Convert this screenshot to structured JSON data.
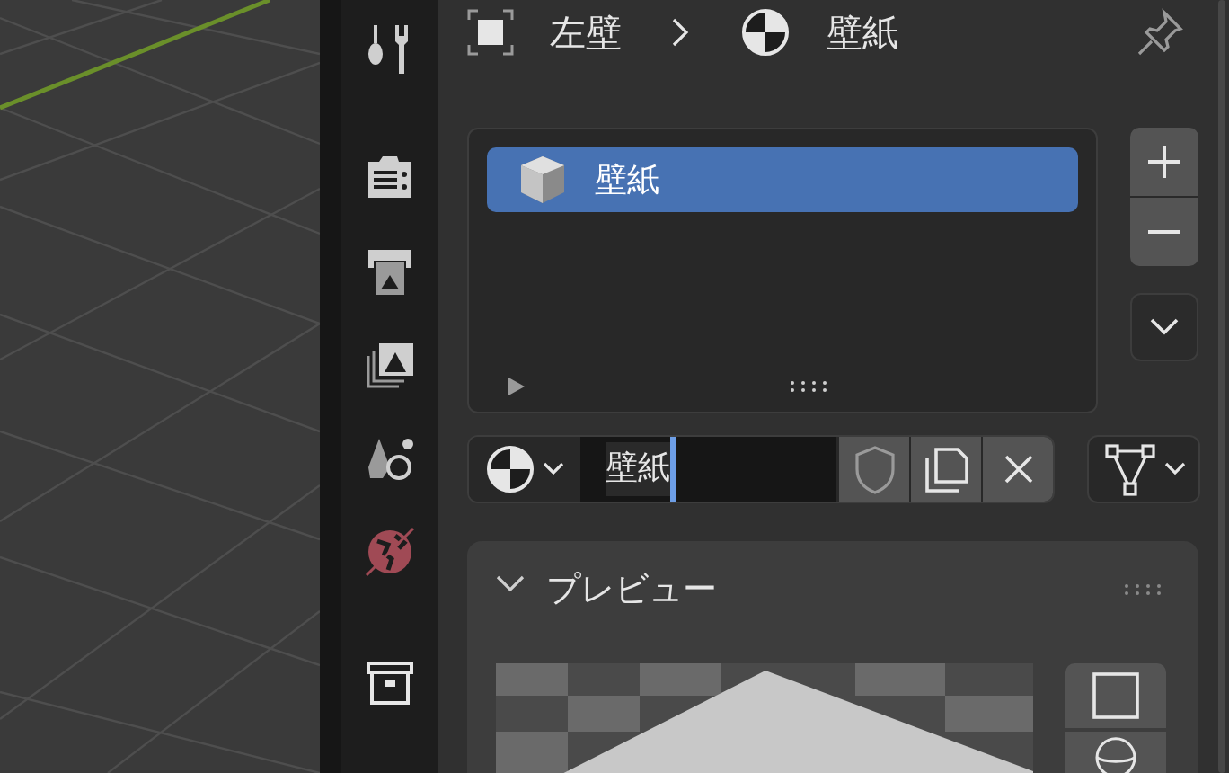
{
  "breadcrumb": [
    {
      "label": "左壁"
    },
    {
      "label": "壁紙"
    }
  ],
  "slots": [
    {
      "label": "壁紙",
      "selected": true
    }
  ],
  "datablock": {
    "value": "壁紙"
  },
  "panels": [
    {
      "title": "プレビュー",
      "expanded": true
    }
  ]
}
